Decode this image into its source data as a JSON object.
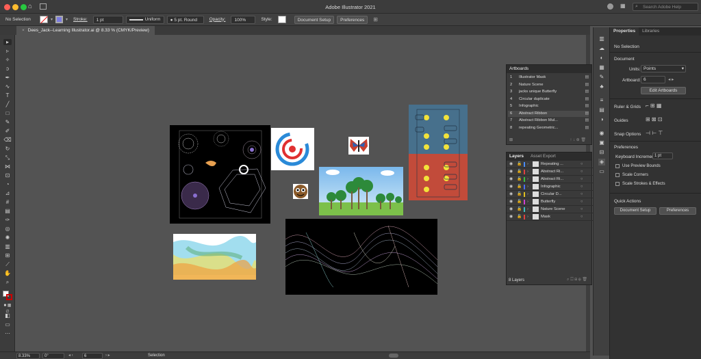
{
  "app": {
    "title": "Adobe Illustrator 2021",
    "search_placeholder": "Search Adobe Help"
  },
  "control": {
    "selection": "No Selection",
    "stroke_label": "Stroke:",
    "stroke_value": "1 pt",
    "stroke_style": "Uniform",
    "brush": "5 pt. Round",
    "opacity_label": "Opacity:",
    "opacity_value": "100%",
    "style_label": "Style:",
    "doc_setup": "Document Setup",
    "preferences": "Preferences"
  },
  "document": {
    "tab_title": "Dees_Jack--Learning Illustrator.ai @ 8.33 % (CMYK/Preview)"
  },
  "status": {
    "zoom": "8.33%",
    "rotation": "0°",
    "artboard": "6",
    "tool": "Selection"
  },
  "artboards_panel": {
    "title": "Artboards",
    "items": [
      {
        "num": "1",
        "name": "Illustrator Mask"
      },
      {
        "num": "2",
        "name": "Nature Scene"
      },
      {
        "num": "3",
        "name": "jacks unique Butterfly"
      },
      {
        "num": "4",
        "name": "Circular duplicate"
      },
      {
        "num": "5",
        "name": "Infographic"
      },
      {
        "num": "6",
        "name": "Abstract Ribbon"
      },
      {
        "num": "7",
        "name": "Abstract Ribbon Mul..."
      },
      {
        "num": "8",
        "name": "repeating Geometric..."
      }
    ]
  },
  "layers_panel": {
    "tabs": [
      "Layers",
      "Asset Export"
    ],
    "count": "8 Layers",
    "items": [
      {
        "name": "Repeating ...",
        "color": "#4a8cf7"
      },
      {
        "name": "Abstract Ri...",
        "color": "#e04040"
      },
      {
        "name": "Abstract Ri...",
        "color": "#3fbf3f"
      },
      {
        "name": "Infographic",
        "color": "#4a6cf7"
      },
      {
        "name": "Circular D...",
        "color": "#e0c020"
      },
      {
        "name": "Butterfly",
        "color": "#d040d0"
      },
      {
        "name": "Nature Scene",
        "color": "#40c0c0"
      },
      {
        "name": "Mask",
        "color": "#e04040"
      }
    ]
  },
  "properties": {
    "tabs": [
      "Properties",
      "Libraries"
    ],
    "no_selection": "No Selection",
    "document": "Document",
    "units_label": "Units:",
    "units_value": "Points",
    "artboard_label": "Artboard:",
    "artboard_value": "6",
    "edit_artboards": "Edit Artboards",
    "ruler_grids": "Ruler & Grids",
    "guides": "Guides",
    "snap_options": "Snap Options",
    "preferences": "Preferences",
    "keyboard_increment_label": "Keyboard Increment:",
    "keyboard_increment_value": "1 pt",
    "use_preview_bounds": "Use Preview Bounds",
    "scale_corners": "Scale Corners",
    "scale_strokes": "Scale Strokes & Effects",
    "quick_actions": "Quick Actions",
    "document_setup": "Document Setup",
    "prefs_button": "Preferences"
  }
}
